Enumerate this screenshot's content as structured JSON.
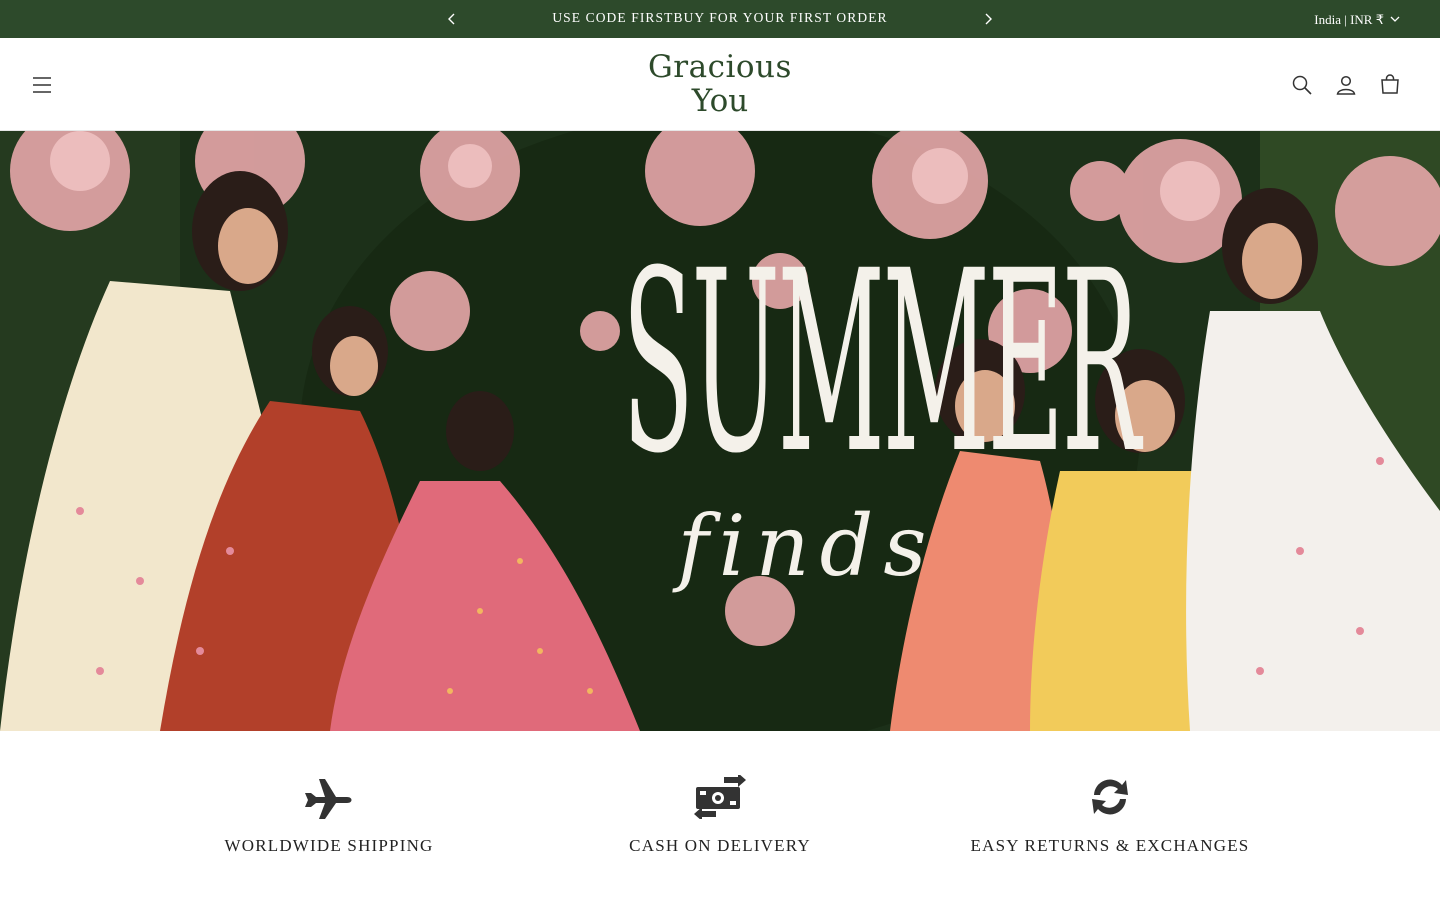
{
  "announcement": {
    "message": "USE CODE FIRSTBUY FOR YOUR FIRST ORDER",
    "prev_icon": "chevron-left-icon",
    "next_icon": "chevron-right-icon",
    "locale": "India | INR ₹"
  },
  "header": {
    "logo_line1": "Gracious",
    "logo_line2": "You",
    "menu_icon": "hamburger-menu-icon",
    "search_icon": "search-icon",
    "account_icon": "account-icon",
    "cart_icon": "cart-icon"
  },
  "hero": {
    "headline": "SUMMER",
    "subheadline": "finds"
  },
  "features": [
    {
      "label": "WORLDWIDE SHIPPING",
      "icon": "airplane-icon"
    },
    {
      "label": "CASH ON DELIVERY",
      "icon": "cash-exchange-icon"
    },
    {
      "label": "EASY RETURNS & EXCHANGES",
      "icon": "refresh-icon"
    }
  ],
  "colors": {
    "brand_green": "#2d4a2b",
    "text_dark": "#222222"
  }
}
